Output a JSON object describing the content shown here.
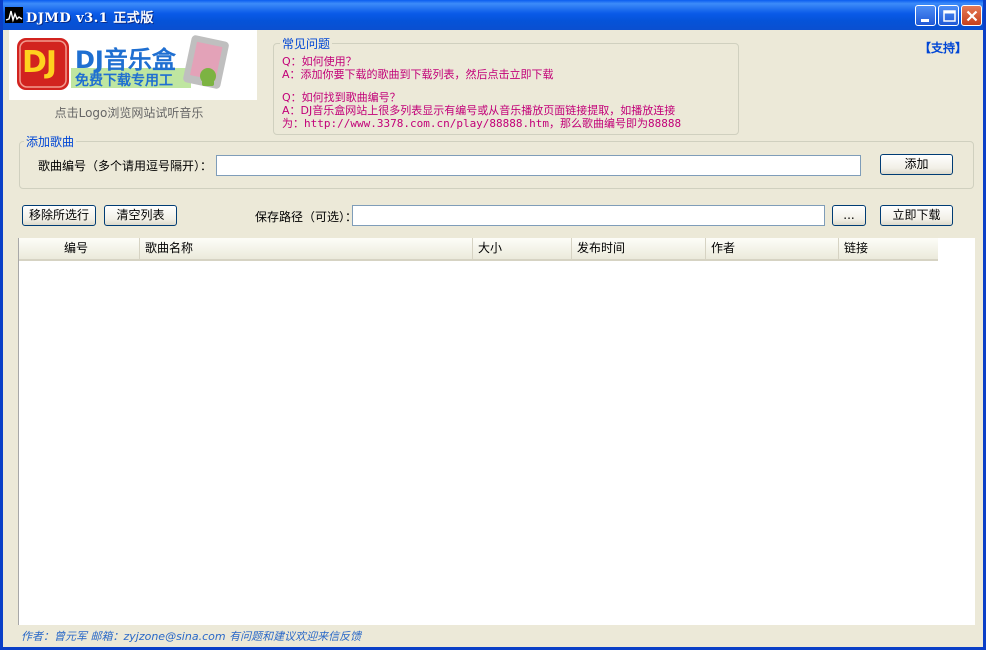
{
  "window": {
    "title": "DJMD  v3.1  正式版"
  },
  "logo": {
    "dj_text": "DJ",
    "brand": "DJ音乐盒",
    "slogan": "免费下载专用工",
    "caption": "点击Logo浏览网站试听音乐"
  },
  "faq": {
    "legend": "常见问题",
    "q1": "Q：如何使用？",
    "a1": "A：添加你要下载的歌曲到下载列表，然后点击立即下载",
    "q2": "Q：如何找到歌曲编号？",
    "a2_line1": "A：DJ音乐盒网站上很多列表显示有编号或从音乐播放页面链接提取，如播放连接",
    "a2_line2": "为：http://www.3378.com.cn/play/88888.htm，那么歌曲编号即为88888"
  },
  "support_link": "【支持】",
  "add_song": {
    "legend": "添加歌曲",
    "label": "歌曲编号（多个请用逗号隔开）：",
    "input_value": "",
    "add_button": "添加"
  },
  "toolbar": {
    "remove_button": "移除所选行",
    "clear_button": "清空列表",
    "save_path_label": "保存路径（可选）：",
    "save_path_value": "",
    "browse_button": "...",
    "download_button": "立即下载"
  },
  "table": {
    "columns": [
      "编号",
      "歌曲名称",
      "大小",
      "发布时间",
      "作者",
      "链接"
    ],
    "rows": []
  },
  "footer": "作者：曾元军  邮箱：zyjzone@sina.com 有问题和建议欢迎来信反馈",
  "colors": {
    "titlebar": "#0a5ae8",
    "accent": "#0046d5",
    "faq_text": "#c20078",
    "footer_text": "#2968c8",
    "window_bg": "#ece9d8"
  }
}
